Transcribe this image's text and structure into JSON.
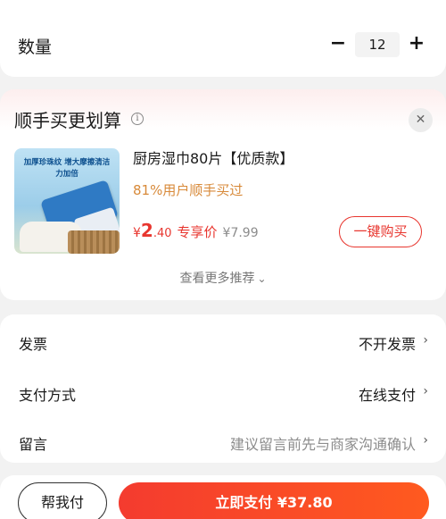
{
  "quantity": {
    "label": "数量",
    "decrement": "−",
    "value": "12",
    "increment": "+"
  },
  "recommend": {
    "title": "顺手买更划算",
    "info_icon": "i",
    "close_icon": "✕",
    "product": {
      "image_text": "加厚珍珠纹 增大摩擦清洁力加倍",
      "name": "厨房湿巾80片【优质款】",
      "stat": "81%用户顺手买过",
      "currency": "¥",
      "price_int": "2",
      "price_dec": ".40",
      "price_tag": "专享价",
      "original_price": "¥7.99",
      "buy_label": "一键购买"
    },
    "more_label": "查看更多推荐",
    "more_icon": "chevron-down-icon"
  },
  "options": [
    {
      "label": "发票",
      "value": "不开发票",
      "hint": false
    },
    {
      "label": "支付方式",
      "value": "在线支付",
      "hint": false
    },
    {
      "label": "留言",
      "value": "建议留言前先与商家沟通确认",
      "hint": true
    }
  ],
  "bottom": {
    "help_label": "帮我付",
    "pay_label": "立即支付 ¥37.80"
  },
  "colors": {
    "accent": "#e8362f",
    "stat": "#d88a3a"
  }
}
